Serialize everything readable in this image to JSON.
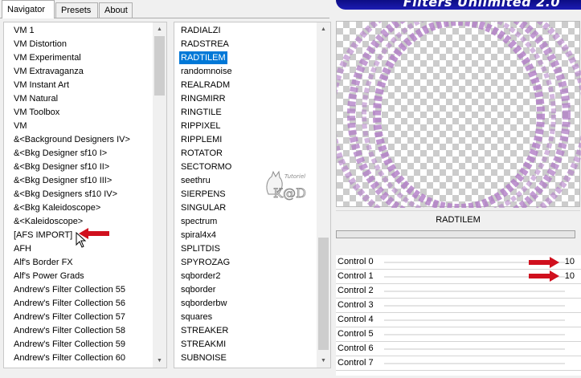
{
  "tabs": [
    {
      "label": "Navigator"
    },
    {
      "label": "Presets"
    },
    {
      "label": "About"
    }
  ],
  "banner": {
    "title": "Filters Unlimited 2.0"
  },
  "categories": {
    "items": [
      "VM 1",
      "VM Distortion",
      "VM Experimental",
      "VM Extravaganza",
      "VM Instant Art",
      "VM Natural",
      "VM Toolbox",
      "VM",
      "&<Background Designers IV>",
      "&<Bkg Designer sf10 I>",
      "&<Bkg Designer sf10 II>",
      "&<Bkg Designer sf10 III>",
      "&<Bkg Designers sf10 IV>",
      "&<Bkg Kaleidoscope>",
      "&<Kaleidoscope>",
      "[AFS IMPORT]",
      "AFH",
      "Alf's Border FX",
      "Alf's Power Grads",
      "Andrew's Filter Collection 55",
      "Andrew's Filter Collection 56",
      "Andrew's Filter Collection 57",
      "Andrew's Filter Collection 58",
      "Andrew's Filter Collection 59",
      "Andrew's Filter Collection 60"
    ]
  },
  "filters": {
    "items": [
      "RADIALZI",
      "RADSTREA",
      "RADTILEM",
      "randomnoise",
      "REALRADM",
      "RINGMIRR",
      "RINGTILE",
      "RIPPIXEL",
      "RIPPLEMI",
      "ROTATOR",
      "SECTORMO",
      "seethru",
      "SIERPENS",
      "SINGULAR",
      "spectrum",
      "spiral4x4",
      "SPLITDIS",
      "SPYROZAG",
      "sqborder2",
      "sqborder",
      "sqborderbw",
      "squares",
      "STREAKER",
      "STREAKMI",
      "SUBNOISE"
    ],
    "selected": "RADTILEM"
  },
  "selected_filter_name": "RADTILEM",
  "controls": [
    {
      "label": "Control 0",
      "value": "10"
    },
    {
      "label": "Control 1",
      "value": "10"
    },
    {
      "label": "Control 2",
      "value": ""
    },
    {
      "label": "Control 3",
      "value": ""
    },
    {
      "label": "Control 4",
      "value": ""
    },
    {
      "label": "Control 5",
      "value": ""
    },
    {
      "label": "Control 6",
      "value": ""
    },
    {
      "label": "Control 7",
      "value": ""
    }
  ],
  "watermark": {
    "small": "Tutoriel",
    "main": "K@D"
  },
  "colors": {
    "accent": "#0078d7",
    "annotation": "#d0101e",
    "preview_ring": "#b07cc6"
  },
  "icons": [
    "right-arrow-annotation-icon",
    "left-arrow-annotation-icon",
    "cursor-icon",
    "scroll-up-icon",
    "scroll-down-icon"
  ]
}
